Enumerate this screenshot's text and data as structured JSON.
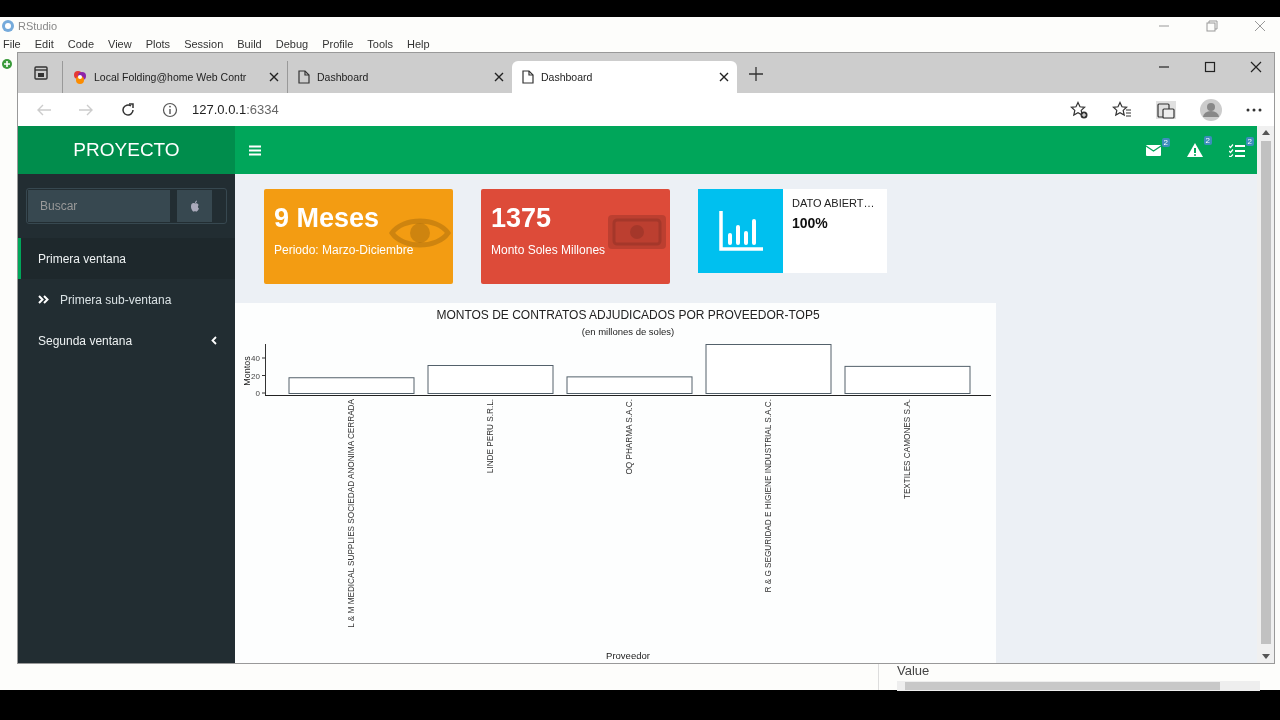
{
  "rstudio": {
    "title": "RStudio",
    "menu": [
      "File",
      "Edit",
      "Code",
      "View",
      "Plots",
      "Session",
      "Build",
      "Debug",
      "Profile",
      "Tools",
      "Help"
    ],
    "pane_label": "Value"
  },
  "browser": {
    "tabs": [
      {
        "label": "Local Folding@home Web Contr",
        "selected": false,
        "kind": "site"
      },
      {
        "label": "Dashboard",
        "selected": false,
        "kind": "page"
      },
      {
        "label": "Dashboard",
        "selected": true,
        "kind": "page"
      }
    ],
    "address": {
      "host": "127.0.0.1",
      "port": ":6334"
    }
  },
  "dashboard": {
    "logo": "PROYECTO",
    "notifications": [
      {
        "kind": "mail",
        "count": "2"
      },
      {
        "kind": "warning",
        "count": "2"
      },
      {
        "kind": "tasks",
        "count": "2"
      }
    ],
    "search": {
      "placeholder": "Buscar"
    },
    "sidebar": {
      "items": [
        {
          "label": "Primera ventana",
          "kind": "plain",
          "selected": true
        },
        {
          "label": "Primera sub-ventana",
          "kind": "sub",
          "selected": false
        },
        {
          "label": "Segunda ventana",
          "kind": "group",
          "selected": false
        }
      ]
    },
    "boxes": [
      {
        "kind": "small",
        "color": "#f39c12",
        "value": "9 Meses",
        "subtitle": "Periodo: Marzo-Diciembre"
      },
      {
        "kind": "small",
        "color": "#dd4b39",
        "value": "1375",
        "subtitle": "Monto Soles Millones"
      },
      {
        "kind": "info",
        "color": "#00c0ef",
        "label": "DATO ABIERT…",
        "value": "100%"
      }
    ],
    "chart": {
      "subtitle": "(en millones de soles)",
      "chart_data": {
        "type": "bar",
        "title": "MONTOS DE CONTRATOS ADJUDICADOS POR PROVEEDOR-TOP5",
        "xlabel": "Proveedor",
        "ylabel": "Montos",
        "categories": [
          "L & M MEDICAL SUPPLIES SOCIEDAD ANONIMA CERRADA",
          "LINDE PERU S.R.L.",
          "OQ PHARMA S.A.C.",
          "R & G SEGURIDAD E HIGIENE INDUSTRIAL S.A.C.",
          "TEXTILES CAMONES S.A."
        ],
        "values": [
          18,
          32,
          19,
          56,
          31
        ],
        "ylim": [
          0,
          56
        ],
        "yticks": [
          0,
          20,
          40
        ]
      }
    }
  }
}
